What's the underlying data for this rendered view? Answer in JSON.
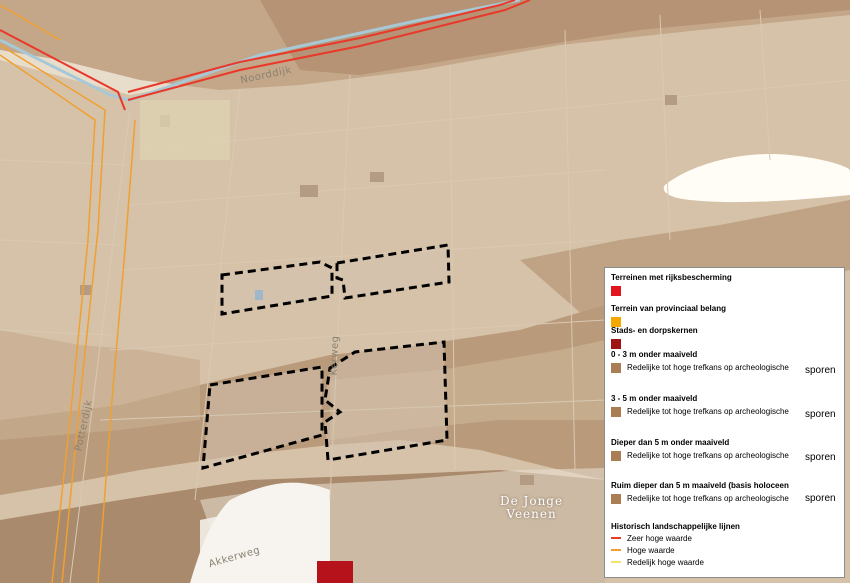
{
  "map": {
    "road_labels": {
      "noorddijk": "Noorddijk",
      "potterdijk": "Potterdijk",
      "akkerweg": "Akkerweg",
      "kerkweg": "Kerweg"
    },
    "place_label": {
      "line1": "De Jonge",
      "line2": "Veenen"
    },
    "colors": {
      "background": "#e8dccb",
      "zone_light": "#d8c6b0",
      "zone_dark": "#b89a7c",
      "zone_darkest": "#a48466",
      "white_patch": "#fffdf5",
      "built_area": "#efece6"
    }
  },
  "legend": {
    "sections": [
      {
        "title": "Terreinen met rijksbescherming",
        "swatch": "#e3151d"
      },
      {
        "title": "Terrein van provinciaal belang",
        "swatch": "#f5a800"
      },
      {
        "title": "Stads- en dorpskernen",
        "swatch": "#9e1414"
      },
      {
        "title": "0 - 3 m onder maaiveld",
        "swatch": "#a97e55",
        "item": "Redelijke tot hoge trefkans op archeologische",
        "suffix": "sporen"
      },
      {
        "title": "3 - 5 m onder maaiveld",
        "swatch": "#a97e55",
        "item": "Redelijke tot hoge trefkans op archeologische",
        "suffix": "sporen"
      },
      {
        "title": "Dieper dan 5 m onder maaiveld",
        "swatch": "#a97e55",
        "item": "Redelijke tot hoge trefkans op archeologische",
        "suffix": "sporen"
      },
      {
        "title": "Ruim dieper dan 5 m maaiveld (basis holoceen",
        "swatch": "#a97e55",
        "item": "Redelijke tot hoge trefkans op archeologische",
        "suffix": "sporen"
      }
    ],
    "lines": {
      "title": "Historisch landschappelijke lijnen",
      "items": [
        {
          "label": "Zeer hoge waarde",
          "color": "#e8392b"
        },
        {
          "label": "Hoge waarde",
          "color": "#f0a030"
        },
        {
          "label": "Redelijk hoge waarde",
          "color": "#f2e36a"
        }
      ]
    }
  }
}
